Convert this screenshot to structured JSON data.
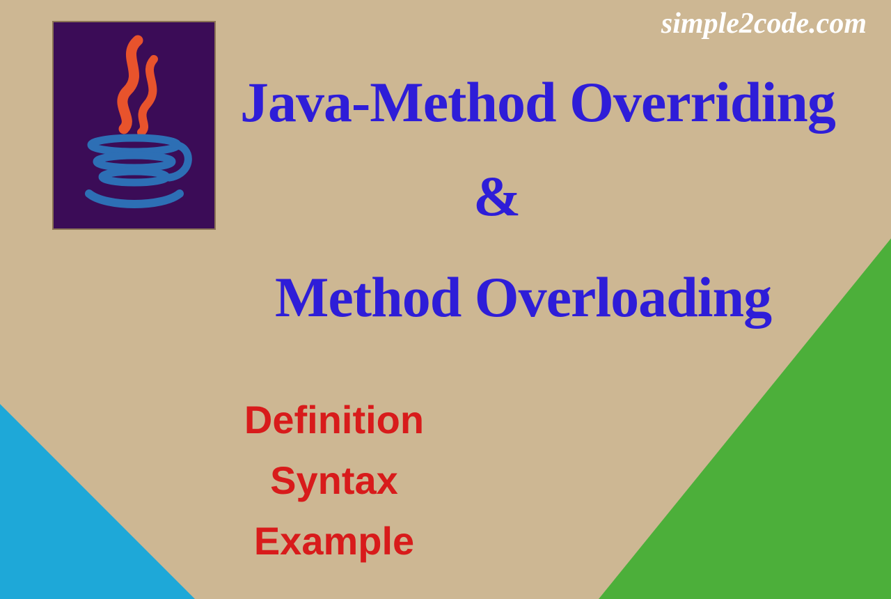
{
  "watermark": "simple2code.com",
  "headline": {
    "line1": "Java-Method Overriding",
    "amp": "&",
    "line2": "Method Overloading"
  },
  "sublist": {
    "item1": "Definition",
    "item2": "Syntax",
    "item3": "Example"
  },
  "colors": {
    "bg": "#cdb793",
    "logoBox": "#3b0c57",
    "headline": "#2e1dd8",
    "sublist": "#d81b1b",
    "triGreen": "#4caf3a",
    "triBlue": "#1ea8d8",
    "watermark": "#ffffff"
  }
}
